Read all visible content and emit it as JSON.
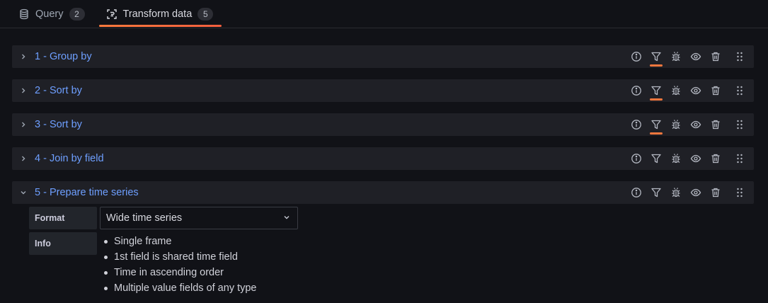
{
  "tabs": [
    {
      "label": "Query",
      "count": "2",
      "icon": "database-icon"
    },
    {
      "label": "Transform data",
      "count": "5",
      "icon": "transform-icon"
    }
  ],
  "active_tab": "Transform data",
  "accent_color": "#f5773e",
  "link_color": "#6e9fff",
  "transformations": [
    {
      "title": "1 - Group by",
      "filter_active": true,
      "expanded": false
    },
    {
      "title": "2 - Sort by",
      "filter_active": true,
      "expanded": false
    },
    {
      "title": "3 - Sort by",
      "filter_active": true,
      "expanded": false
    },
    {
      "title": "4 - Join by field",
      "filter_active": false,
      "expanded": false
    },
    {
      "title": "5 - Prepare time series",
      "filter_active": false,
      "expanded": true
    }
  ],
  "row_action_icons": [
    "info-icon",
    "filter-icon",
    "debug-icon",
    "eye-icon",
    "trash-icon",
    "drag-handle-icon"
  ],
  "editor": {
    "format_label": "Format",
    "format_value": "Wide time series",
    "info_label": "Info",
    "info_items": [
      "Single frame",
      "1st field is shared time field",
      "Time in ascending order",
      "Multiple value fields of any type"
    ]
  }
}
